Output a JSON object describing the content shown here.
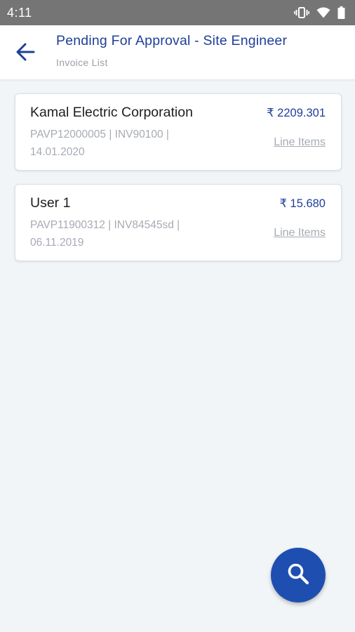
{
  "status_bar": {
    "time": "4:11",
    "icons": [
      "vibrate-icon",
      "wifi-icon",
      "battery-icon"
    ]
  },
  "header": {
    "title": "Pending For Approval - Site Engineer",
    "subtitle": "Invoice List",
    "back_icon": "arrow-back-icon"
  },
  "invoices": [
    {
      "name": "Kamal Electric Corporation",
      "amount": "₹ 2209.301",
      "meta": "PAVP12000005 | INV90100 | 14.01.2020",
      "link": "Line Items"
    },
    {
      "name": "User 1",
      "amount": "₹ 15.680",
      "meta": "PAVP11900312 | INV84545sd | 06.11.2019",
      "link": "Line Items"
    }
  ],
  "fab": {
    "icon": "search-icon"
  },
  "colors": {
    "accent": "#1f3f99",
    "fab": "#1e4fb0",
    "background": "#f2f5f8",
    "muted_text": "#a6abb3",
    "status_bar": "#757575"
  }
}
